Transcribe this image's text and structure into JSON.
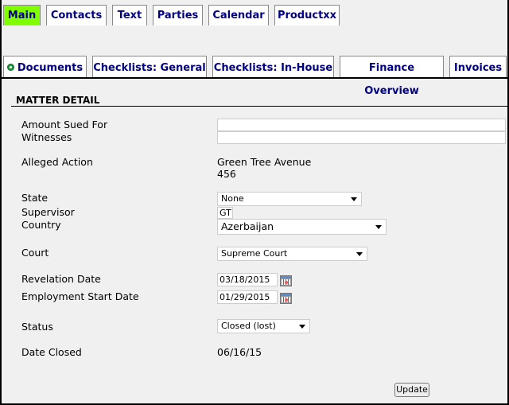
{
  "tabs_row1": [
    {
      "label": "Main",
      "active": true
    },
    {
      "label": "Contacts"
    },
    {
      "label": "Text"
    },
    {
      "label": "Parties"
    },
    {
      "label": "Calendar"
    },
    {
      "label": "Productxx"
    }
  ],
  "tabs_row2": [
    {
      "label": "Documents",
      "icon": "circle-status-icon"
    },
    {
      "label": "Checklists: General"
    },
    {
      "label": "Checklists: In-House"
    },
    {
      "label": "Finance Overview"
    },
    {
      "label": "Invoices"
    }
  ],
  "section": {
    "title": "MATTER DETAIL"
  },
  "fields": {
    "amount_sued_for": {
      "label": "Amount Sued For",
      "value": ""
    },
    "witnesses": {
      "label": "Witnesses",
      "value": ""
    },
    "alleged_action": {
      "label": "Alleged Action",
      "line1": "Green Tree Avenue",
      "line2": "456"
    },
    "state": {
      "label": "State",
      "value": "None"
    },
    "supervisor": {
      "label": "Supervisor",
      "value": "GT"
    },
    "country": {
      "label": "Country",
      "value": "Azerbaijan"
    },
    "court": {
      "label": "Court",
      "value": "Supreme Court"
    },
    "revelation_date": {
      "label": "Revelation Date",
      "value": "03/18/2015"
    },
    "employment_start_date": {
      "label": "Employment Start Date",
      "value": "01/29/2015"
    },
    "status": {
      "label": "Status",
      "value": "Closed (lost)"
    },
    "date_closed": {
      "label": "Date Closed",
      "value": "06/16/15"
    }
  },
  "buttons": {
    "update": "Update"
  },
  "colors": {
    "active_tab": "#80ff00",
    "tab_text": "#000080"
  }
}
